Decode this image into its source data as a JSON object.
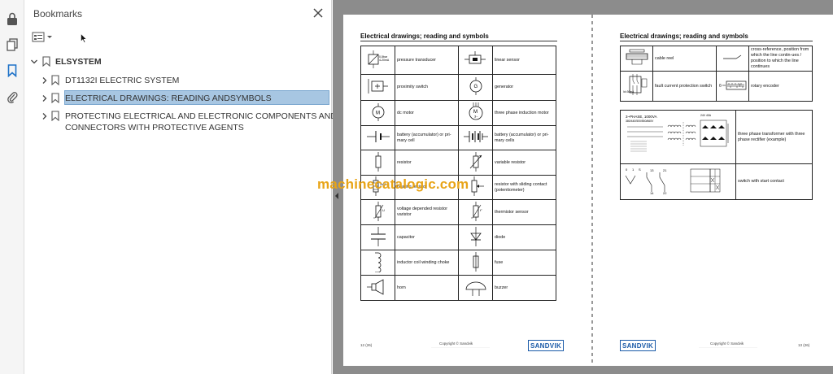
{
  "rail": {
    "icons": [
      "lock-icon",
      "pages-icon",
      "bookmark-icon",
      "paperclip-icon"
    ]
  },
  "bookmarks_panel": {
    "title": "Bookmarks",
    "items": [
      {
        "label": "ELSYSTEM",
        "level": 0,
        "expanded": true
      },
      {
        "label": "DT1132I ELECTRIC SYSTEM",
        "level": 1,
        "expanded": false
      },
      {
        "label": "ELECTRICAL DRAWINGS: READING ANDSYMBOLS",
        "level": 1,
        "expanded": false,
        "selected": true
      },
      {
        "label_line1": "PROTECTING ELECTRICAL AND ELECTRONIC COMPONENTS AND",
        "label_line2": "CONNECTORS WITH PROTECTIVE AGENTS",
        "level": 1,
        "expanded": false
      }
    ]
  },
  "page_left": {
    "title": "Electrical drawings; reading and symbols",
    "rows": [
      {
        "a": "pressure transducer",
        "b": "linear sensor"
      },
      {
        "a": "proximity switch",
        "b": "generator"
      },
      {
        "a": "dc motor",
        "b": "three phase induction motor"
      },
      {
        "a": "battery (accumulator) or pri-mary cell",
        "b": "battery (accumulator) or pri-mary cells"
      },
      {
        "a": "resistor",
        "b": "variable resistor"
      },
      {
        "a": "heating resistor",
        "b": "resistor with sliding contact (potentiometer)"
      },
      {
        "a": "voltage depended resistor varistor",
        "b": "thermistor sensor"
      },
      {
        "a": "capacitor",
        "b": "diode"
      },
      {
        "a": "inductor coil winding choke",
        "b": "fuse"
      },
      {
        "a": "horn",
        "b": "buzzer"
      }
    ],
    "icon_texts": {
      "pressure": "0-5bar\n4-20mA",
      "heating": "2kW",
      "dc_motor": "M",
      "three_phase": "M\n3~",
      "generator": "G"
    },
    "footer_page": "12 (26)",
    "footer_copy": "Copyright © Sandvik",
    "logo": "SANDVIK"
  },
  "page_right": {
    "title": "Electrical drawings; reading and symbols",
    "rows": [
      {
        "a": "cable reel",
        "b": "cross-reference, position from which the line contin-ues / position to which the line continues"
      },
      {
        "a": "fault current protection switch",
        "b": "rotary encoder"
      }
    ],
    "fault_label": "Id=30mA",
    "transformer_label": "3~PHASE, 1000VA\n380/440/500/550/660V",
    "transformer_desc": "three phase transformer with three phase rectifier (example)",
    "transformer_out": "24V 40A",
    "switch_desc": "switch with start contact",
    "footer_page": "13 (26)",
    "footer_copy": "Copyright © Sandvik",
    "logo": "SANDVIK"
  },
  "watermark": "machinecatalogic.com",
  "colors": {
    "selection": "#a7c6e2",
    "watermark": "#e8a417",
    "brand": "#1a5aa8",
    "viewer_bg": "#8c8c8c"
  }
}
